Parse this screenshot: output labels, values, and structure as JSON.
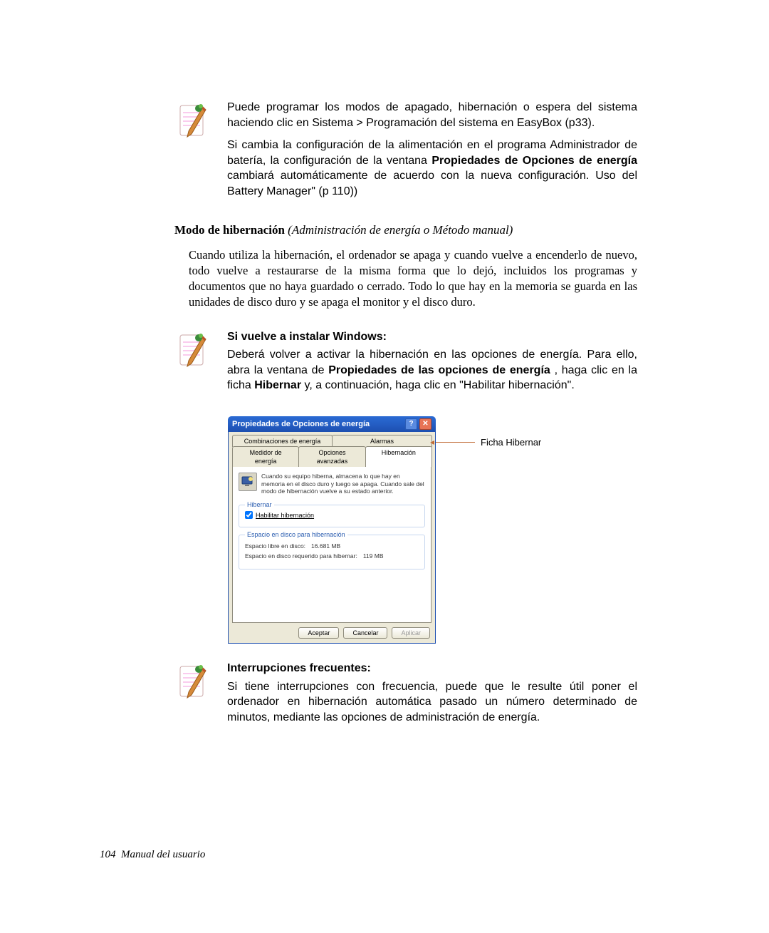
{
  "note1": {
    "p1": "Puede programar los modos de apagado, hibernación o espera del sistema haciendo clic en Sistema > Programación del sistema en EasyBox (p33).",
    "p2_pre": "Si cambia la configuración de la alimentación en el programa Administrador de batería, la configuración de la ventana ",
    "p2_bold": "Propiedades de Opciones de energía",
    "p2_mid": " cambiará automáticamente de acuerdo con la nueva configuración. Uso del Battery Manager\" (p 110))"
  },
  "section": {
    "title_bold": "Modo de hibernación",
    "title_ital": " (Administración de energía o Método manual)",
    "body": "Cuando utiliza la hibernación, el ordenador se apaga y cuando vuelve a encenderlo de nuevo, todo vuelve a restaurarse de la misma forma que lo dejó, incluidos los programas y documentos que no haya guardado o cerrado. Todo lo que hay en la memoria se guarda en las unidades de disco duro y se apaga el monitor y el disco duro."
  },
  "note2": {
    "head": "Si vuelve a instalar Windows:",
    "p_pre": "Deberá volver a activar la hibernación en las opciones de energía. Para ello, abra la ventana de ",
    "p_b1": "Propiedades de las opciones de energía",
    "p_mid1": " , haga clic en la ficha ",
    "p_b2": "Hibernar",
    "p_mid2": " y, a continuación, haga clic en \"Habilitar hibernación\"."
  },
  "dialog": {
    "title": "Propiedades de Opciones de energía",
    "tabs": {
      "row1": [
        "Combinaciones de energía",
        "Alarmas"
      ],
      "row2": [
        "Medidor de energía",
        "Opciones avanzadas",
        "Hibernación"
      ]
    },
    "desc": "Cuando su equipo hiberna, almacena lo que hay en memoria en el disco duro y luego se apaga. Cuando sale del modo de hibernación vuelve a su estado anterior.",
    "fieldset1_legend": "Hibernar",
    "checkbox_label": "Habilitar hibernación",
    "fieldset2_legend": "Espacio en disco para hibernación",
    "disk_free_label": "Espacio libre en disco:",
    "disk_free_value": "16.681 MB",
    "disk_req_label": "Espacio en disco requerido para hibernar:",
    "disk_req_value": "119 MB",
    "btn_ok": "Aceptar",
    "btn_cancel": "Cancelar",
    "btn_apply": "Aplicar"
  },
  "callout_label": "Ficha Hibernar",
  "note3": {
    "head": "Interrupciones frecuentes:",
    "body": "Si tiene interrupciones con frecuencia, puede que le resulte útil poner el ordenador en hibernación automática pasado un número determinado de minutos, mediante las opciones de administración de energía."
  },
  "footer": {
    "page": "104",
    "label": "Manual del usuario"
  }
}
